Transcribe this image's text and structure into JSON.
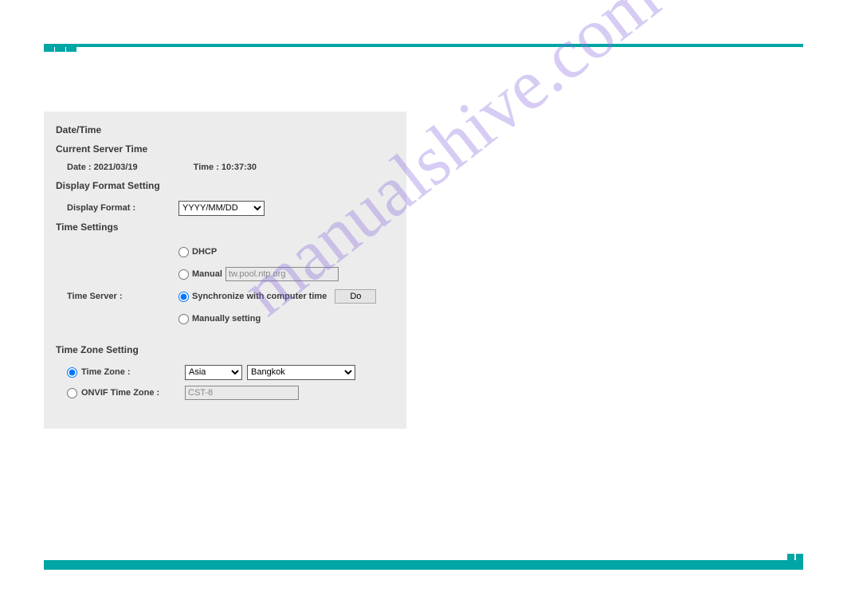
{
  "watermark": "manualshive.com",
  "sections": {
    "datetime_title": "Date/Time",
    "current_server_time_title": "Current Server Time",
    "date_label": "Date : 2021/03/19",
    "time_label": "Time : 10:37:30",
    "display_format_title": "Display Format Setting",
    "display_format_label": "Display Format :",
    "display_format_value": "YYYY/MM/DD",
    "time_settings_title": "Time Settings",
    "time_server_label": "Time Server :",
    "dhcp_label": "DHCP",
    "manual_label": "Manual",
    "ntp_value": "tw.pool.ntp.org",
    "sync_label": "Synchronize with computer time",
    "do_button": "Do",
    "manually_label": "Manually setting",
    "timezone_title": "Time Zone Setting",
    "timezone_label": "Time Zone :",
    "region_value": "Asia",
    "city_value": "Bangkok",
    "onvif_label": "ONVIF Time Zone :",
    "onvif_value": "CST-8"
  }
}
